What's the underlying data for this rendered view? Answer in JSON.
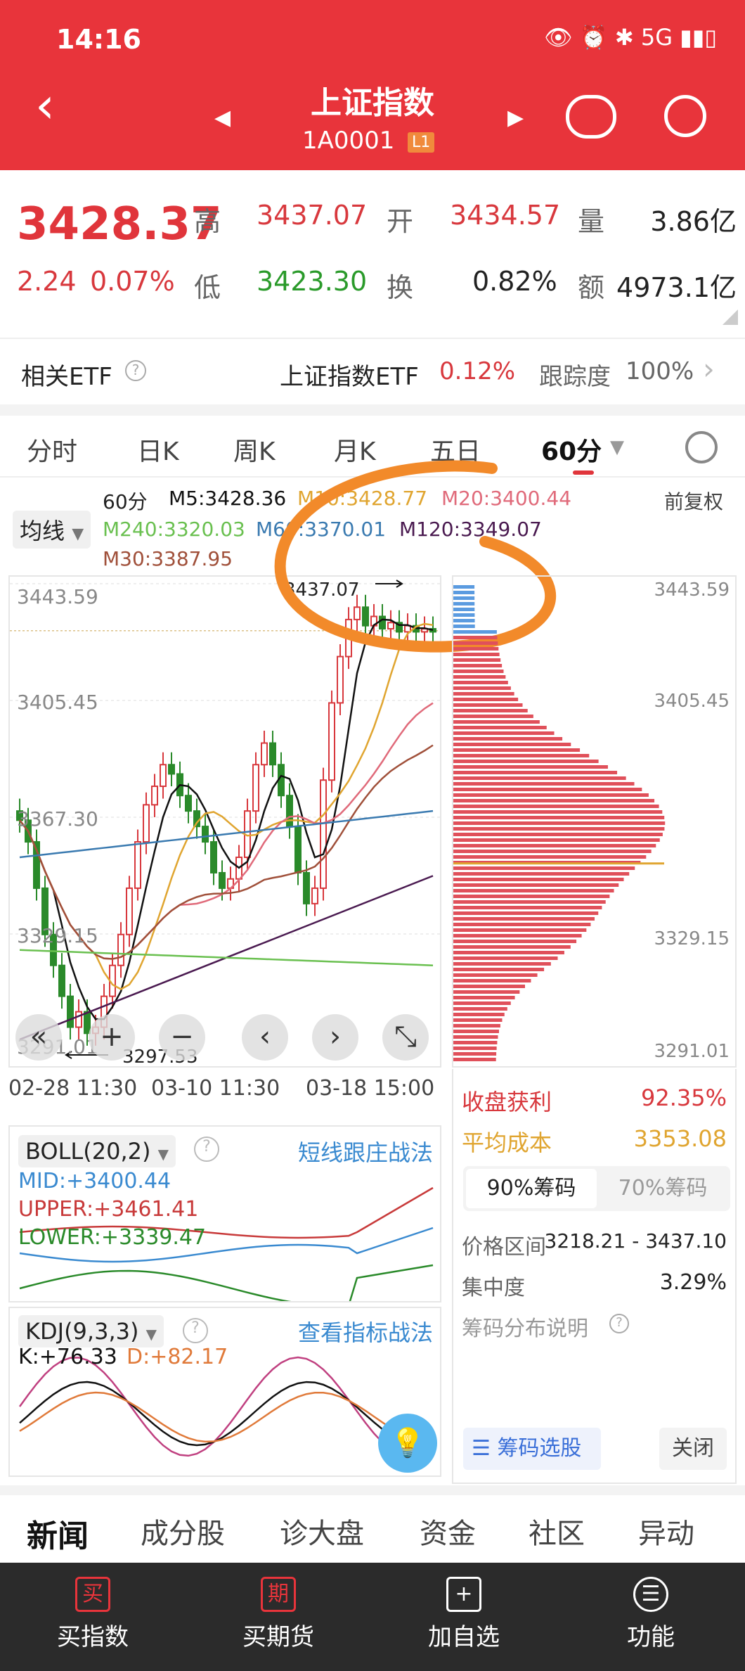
{
  "status": {
    "time": "14:16",
    "network": "5G"
  },
  "header": {
    "title": "上证指数",
    "code": "1A0001",
    "level": "L1"
  },
  "quote": {
    "price": "3428.37",
    "change": "2.24",
    "change_pct": "0.07%",
    "high_label": "高",
    "high": "3437.07",
    "open_label": "开",
    "open": "3434.57",
    "vol_label": "量",
    "vol": "3.86亿",
    "low_label": "低",
    "low": "3423.30",
    "turn_label": "换",
    "turn": "0.82%",
    "amt_label": "额",
    "amt": "4973.1亿"
  },
  "etf": {
    "label": "相关ETF",
    "name": "上证指数ETF",
    "pct": "0.12%",
    "track_label": "跟踪度",
    "track": "100%"
  },
  "tabs": [
    "分时",
    "日K",
    "周K",
    "月K",
    "五日",
    "60分"
  ],
  "active_tab": "60分",
  "legend": {
    "ma_btn": "均线",
    "period": "60分",
    "m5": "M5:3428.36",
    "m10": "M10:3428.77",
    "m20": "M20:3400.44",
    "m240": "M240:3320.03",
    "m60": "M60:3370.01",
    "m120": "M120:3349.07",
    "m30": "M30:3387.95",
    "adjust": "前复权"
  },
  "chart": {
    "y_labels": [
      "3443.59",
      "3405.45",
      "3367.30",
      "3329.15",
      "3291.01"
    ],
    "high_mark": "3437.07",
    "low_mark": "3297.53",
    "x_labels": [
      "02-28 11:30",
      "03-10 11:30",
      "03-18 15:00"
    ],
    "price_range": [
      3291.01,
      3443.59
    ],
    "closes": [
      3367,
      3360,
      3345,
      3330,
      3320,
      3310,
      3300,
      3305,
      3298,
      3300,
      3310,
      3320,
      3330,
      3345,
      3360,
      3372,
      3378,
      3385,
      3382,
      3375,
      3370,
      3365,
      3360,
      3350,
      3345,
      3348,
      3355,
      3370,
      3385,
      3392,
      3385,
      3375,
      3365,
      3350,
      3340,
      3345,
      3380,
      3405,
      3420,
      3432,
      3436,
      3430,
      3433,
      3429,
      3431,
      3428,
      3430,
      3428,
      3429,
      3428
    ],
    "colors": {
      "up": "#d8383d",
      "down": "#2a8a2a",
      "m5": "#111111",
      "m10": "#e0a530",
      "m20": "#e06a7a",
      "m30": "#a0503a",
      "m60": "#3a7ab0",
      "m120": "#4a1a50",
      "m240": "#6ac050"
    }
  },
  "chips": {
    "profit_label": "收盘获利",
    "profit": "92.35%",
    "cost_label": "平均成本",
    "cost": "3353.08",
    "tab90": "90%筹码",
    "tab70": "70%筹码",
    "range_label": "价格区间",
    "range": "3218.21 - 3437.10",
    "conc_label": "集中度",
    "conc": "3.29%",
    "explain": "筹码分布说明",
    "select_btn": "筹码选股",
    "close_btn": "关闭"
  },
  "boll": {
    "name": "BOLL(20,2)",
    "link": "短线跟庄战法",
    "mid": "MID:+3400.44",
    "upper": "UPPER:+3461.41",
    "lower": "LOWER:+3339.47"
  },
  "kdj": {
    "name": "KDJ(9,3,3)",
    "link": "查看指标战法",
    "k": "K:+76.33",
    "d": "D:+82.17"
  },
  "bottom_tabs": [
    "新闻",
    "成分股",
    "诊大盘",
    "资金",
    "社区",
    "异动"
  ],
  "nav": [
    {
      "icon": "买",
      "label": "买指数"
    },
    {
      "icon": "期",
      "label": "买期货"
    },
    {
      "icon": "+",
      "label": "加自选"
    },
    {
      "icon": "☰",
      "label": "功能"
    }
  ]
}
